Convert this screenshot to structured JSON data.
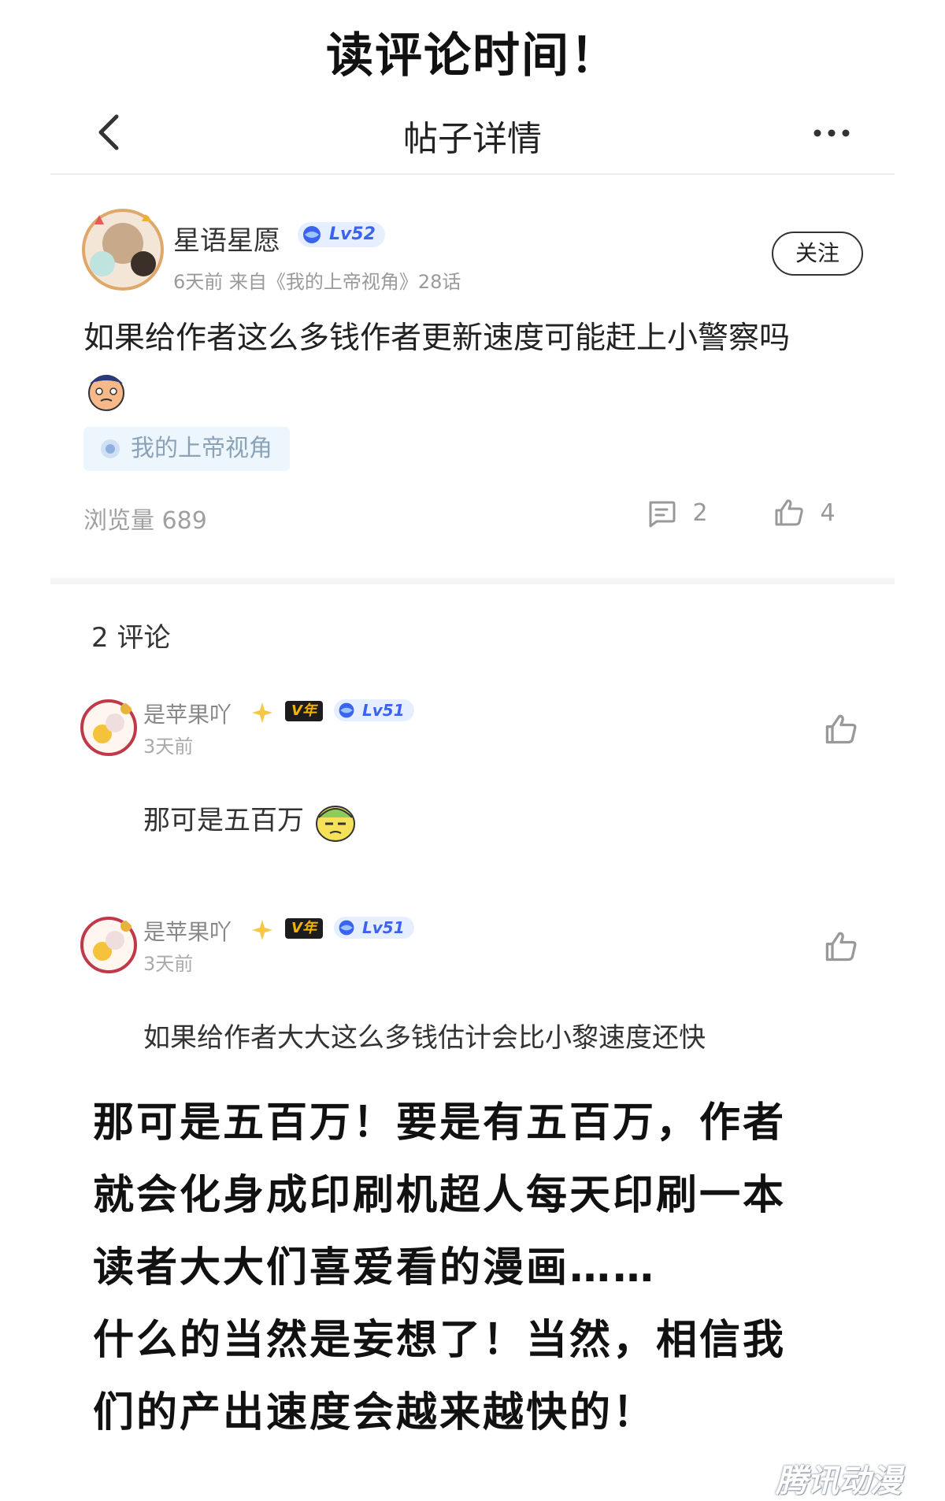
{
  "banner": {
    "title": "读评论时间！"
  },
  "nav": {
    "title": "帖子详情",
    "back_icon": "chevron-left-icon",
    "more_icon": "more-dots-icon"
  },
  "post": {
    "author": "星语星愿",
    "level": "Lv52",
    "meta": "6天前 来自《我的上帝视角》28话",
    "follow_label": "关注",
    "body": "如果给作者这么多钱作者更新速度可能赶上小警察吗",
    "topic": "我的上帝视角",
    "views": "浏览量 689",
    "comments_count": "2",
    "likes_count": "4"
  },
  "comments_header": "2 评论",
  "comments": [
    {
      "name": "是苹果吖",
      "vip": "V年",
      "level": "Lv51",
      "time": "3天前",
      "text": "那可是五百万"
    },
    {
      "name": "是苹果吖",
      "vip": "V年",
      "level": "Lv51",
      "time": "3天前",
      "text": "如果给作者大大这么多钱估计会比小黎速度还快"
    }
  ],
  "footer_note": {
    "lines": [
      "那可是五百万！要是有五百万，作者",
      "就会化身成印刷机超人每天印刷一本",
      "读者大大们喜爱看的漫画……",
      "什么的当然是妄想了！当然，相信我",
      "们的产出速度会越来越快的！"
    ]
  },
  "watermark": "腾讯动漫",
  "colors": {
    "accent_blue": "#3a63f0",
    "vip_gold": "#f1b400",
    "muted": "#9a9a9a"
  }
}
